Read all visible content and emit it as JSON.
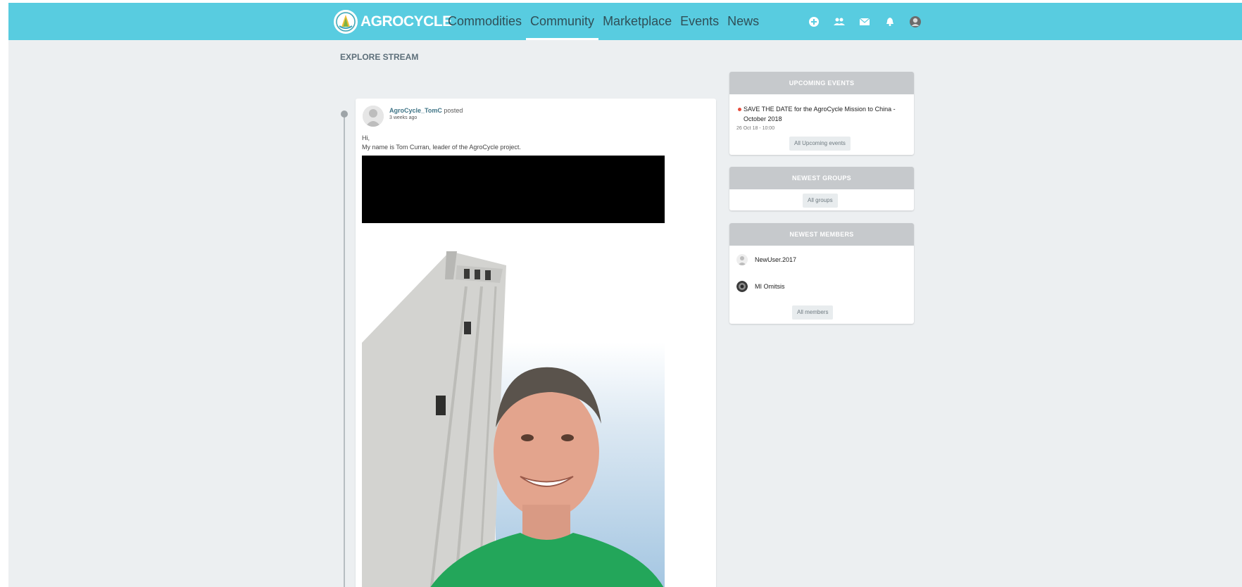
{
  "brand": {
    "name": "AGROCYCLE",
    "color": "#58cce0"
  },
  "nav": {
    "items": [
      {
        "label": "Commodities"
      },
      {
        "label": "Community"
      },
      {
        "label": "Marketplace"
      },
      {
        "label": "Events"
      },
      {
        "label": "News"
      }
    ],
    "active": "Community"
  },
  "header_icons": [
    "plus-circle-icon",
    "users-icon",
    "mail-icon",
    "bell-icon",
    "user-avatar"
  ],
  "stream": {
    "title": "EXPLORE STREAM"
  },
  "post": {
    "author": "AgroCycle_TomC",
    "action": "posted",
    "time": "3 weeks ago",
    "text_line1": "Hi,",
    "text_line2": "My name is Tom Curran, leader of the AgroCycle project."
  },
  "upcoming_events": {
    "header": "UPCOMING EVENTS",
    "items": [
      {
        "title": "SAVE THE DATE for the AgroCycle Mission to China - October 2018",
        "date": "26 Oct 18 - 10:00"
      }
    ],
    "button": "All Upcoming events"
  },
  "newest_groups": {
    "header": "NEWEST GROUPS",
    "button": "All groups"
  },
  "newest_members": {
    "header": "NEWEST MEMBERS",
    "members": [
      {
        "name": "NewUser.2017"
      },
      {
        "name": "MI Omitsis"
      }
    ],
    "button": "All members"
  }
}
